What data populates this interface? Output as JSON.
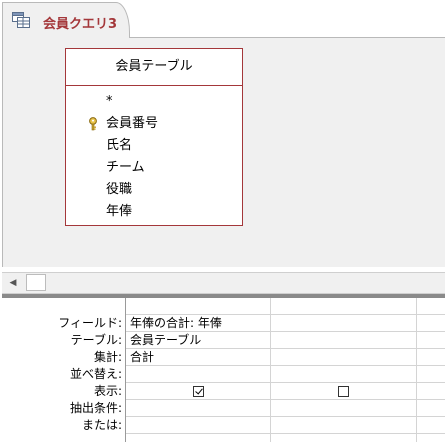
{
  "tab": {
    "title": "会員クエリ3",
    "icon": "query-icon"
  },
  "table_box": {
    "title": "会員テーブル",
    "fields": [
      {
        "label": "*",
        "key": false
      },
      {
        "label": "会員番号",
        "key": true
      },
      {
        "label": "氏名",
        "key": false
      },
      {
        "label": "チーム",
        "key": false
      },
      {
        "label": "役職",
        "key": false
      },
      {
        "label": "年俸",
        "key": false
      }
    ]
  },
  "grid": {
    "row_labels": {
      "field": "フィールド:",
      "table": "テーブル:",
      "total": "集計:",
      "sort": "並べ替え:",
      "show": "表示:",
      "criteria": "抽出条件:",
      "or": "または:"
    },
    "columns": [
      {
        "field": "年俸の合計: 年俸",
        "table": "会員テーブル",
        "total": "合計",
        "sort": "",
        "show": true,
        "criteria": "",
        "or": ""
      },
      {
        "field": "",
        "table": "",
        "total": "",
        "sort": "",
        "show": false,
        "criteria": "",
        "or": ""
      },
      {
        "field": "",
        "table": "",
        "total": "",
        "sort": "",
        "show": null,
        "criteria": "",
        "or": ""
      }
    ]
  },
  "colors": {
    "accent": "#a4373a",
    "pane_bg": "#f0f0f0"
  }
}
